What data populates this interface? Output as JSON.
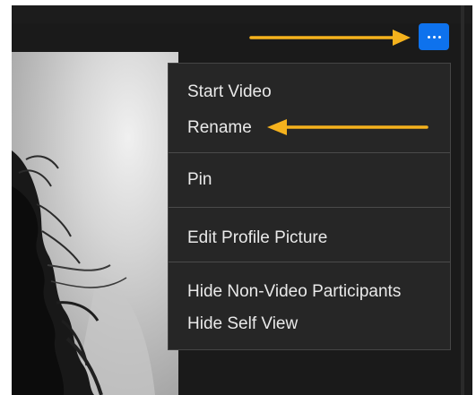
{
  "menu": {
    "items": [
      {
        "label": "Start Video"
      },
      {
        "label": "Rename"
      },
      {
        "label": "Pin"
      },
      {
        "label": "Edit Profile Picture"
      },
      {
        "label": "Hide Non-Video Participants"
      },
      {
        "label": "Hide Self View"
      }
    ]
  },
  "more_button": {
    "icon": "ellipsis-icon",
    "color": "#0e72ed"
  },
  "annotation": {
    "arrow_color": "#f5b21d"
  }
}
